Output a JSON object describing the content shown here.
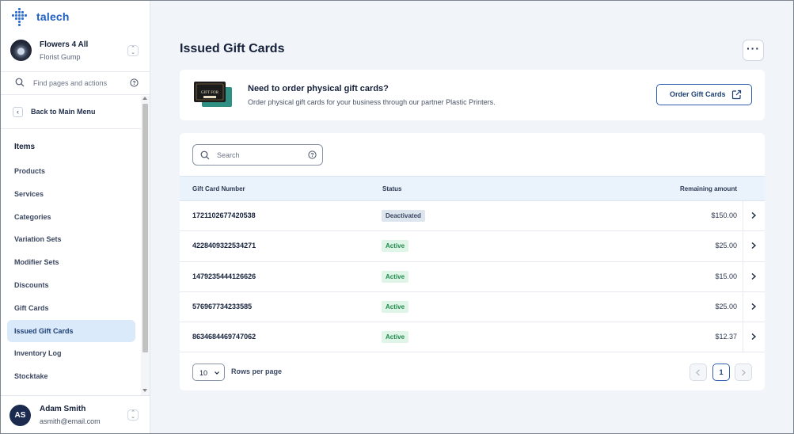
{
  "brand": {
    "name": "talech"
  },
  "store": {
    "name": "Flowers 4 All",
    "owner": "Florist Gump"
  },
  "sidebar": {
    "search_placeholder": "Find pages and actions",
    "back_label": "Back to Main Menu",
    "section_title": "Items",
    "items": [
      {
        "label": "Products",
        "active": false
      },
      {
        "label": "Services",
        "active": false
      },
      {
        "label": "Categories",
        "active": false
      },
      {
        "label": "Variation Sets",
        "active": false
      },
      {
        "label": "Modifier Sets",
        "active": false
      },
      {
        "label": "Discounts",
        "active": false
      },
      {
        "label": "Gift Cards",
        "active": false
      },
      {
        "label": "Issued Gift Cards",
        "active": true
      },
      {
        "label": "Inventory Log",
        "active": false
      },
      {
        "label": "Stocktake",
        "active": false
      }
    ]
  },
  "user": {
    "initials": "AS",
    "name": "Adam Smith",
    "email": "asmith@email.com"
  },
  "page": {
    "title": "Issued Gift Cards",
    "more_icon": "ellipsis-icon"
  },
  "promo": {
    "title": "Need to order physical gift cards?",
    "subtitle": "Order physical gift cards for your business through our partner Plastic Printers.",
    "button_label": "Order Gift Cards",
    "card_art_text": "GIFT FOR"
  },
  "table": {
    "search_placeholder": "Search",
    "columns": [
      "Gift Card Number",
      "Status",
      "Remaining amount"
    ],
    "rows": [
      {
        "number": "1721102677420538",
        "status": "Deactivated",
        "status_kind": "deactivated",
        "amount": "$150.00"
      },
      {
        "number": "4228409322534271",
        "status": "Active",
        "status_kind": "active",
        "amount": "$25.00"
      },
      {
        "number": "1479235444126626",
        "status": "Active",
        "status_kind": "active",
        "amount": "$15.00"
      },
      {
        "number": "576967734233585",
        "status": "Active",
        "status_kind": "active",
        "amount": "$25.00"
      },
      {
        "number": "8634684469747062",
        "status": "Active",
        "status_kind": "active",
        "amount": "$12.37"
      }
    ],
    "rows_per_page": "10",
    "rows_per_page_label": "Rows per page",
    "current_page": "1"
  },
  "colors": {
    "accent": "#1f5fbf",
    "active_nav_bg": "#dbeafb",
    "active_badge_bg": "#dff5e8",
    "active_badge_text": "#1f8a4c",
    "deactivated_badge_bg": "#dde5ef"
  }
}
